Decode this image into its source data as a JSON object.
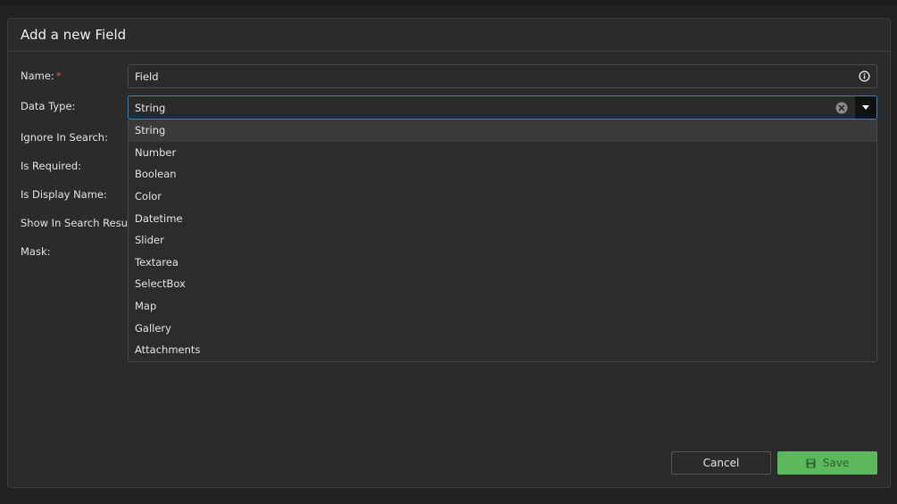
{
  "dialog": {
    "title": "Add a new Field"
  },
  "form": {
    "name_label": "Name:",
    "required_marker": "*",
    "name_value": "Field",
    "data_type_label": "Data Type:",
    "data_type_value": "String",
    "ignore_in_search_label": "Ignore In Search:",
    "is_required_label": "Is Required:",
    "is_display_name_label": "Is Display Name:",
    "show_in_search_result_label": "Show In Search Result:",
    "mask_label": "Mask:"
  },
  "dropdown": {
    "options": [
      "String",
      "Number",
      "Boolean",
      "Color",
      "Datetime",
      "Slider",
      "Textarea",
      "SelectBox",
      "Map",
      "Gallery",
      "Attachments"
    ],
    "selected": "String"
  },
  "footer": {
    "cancel_label": "Cancel",
    "save_label": "Save"
  },
  "colors": {
    "accent": "#2d86c4",
    "save": "#5cb85c",
    "required": "#e05252"
  },
  "icons": {
    "info": "info-icon",
    "clear": "clear-icon",
    "caret": "caret-down-icon",
    "save": "floppy-disk-icon"
  }
}
